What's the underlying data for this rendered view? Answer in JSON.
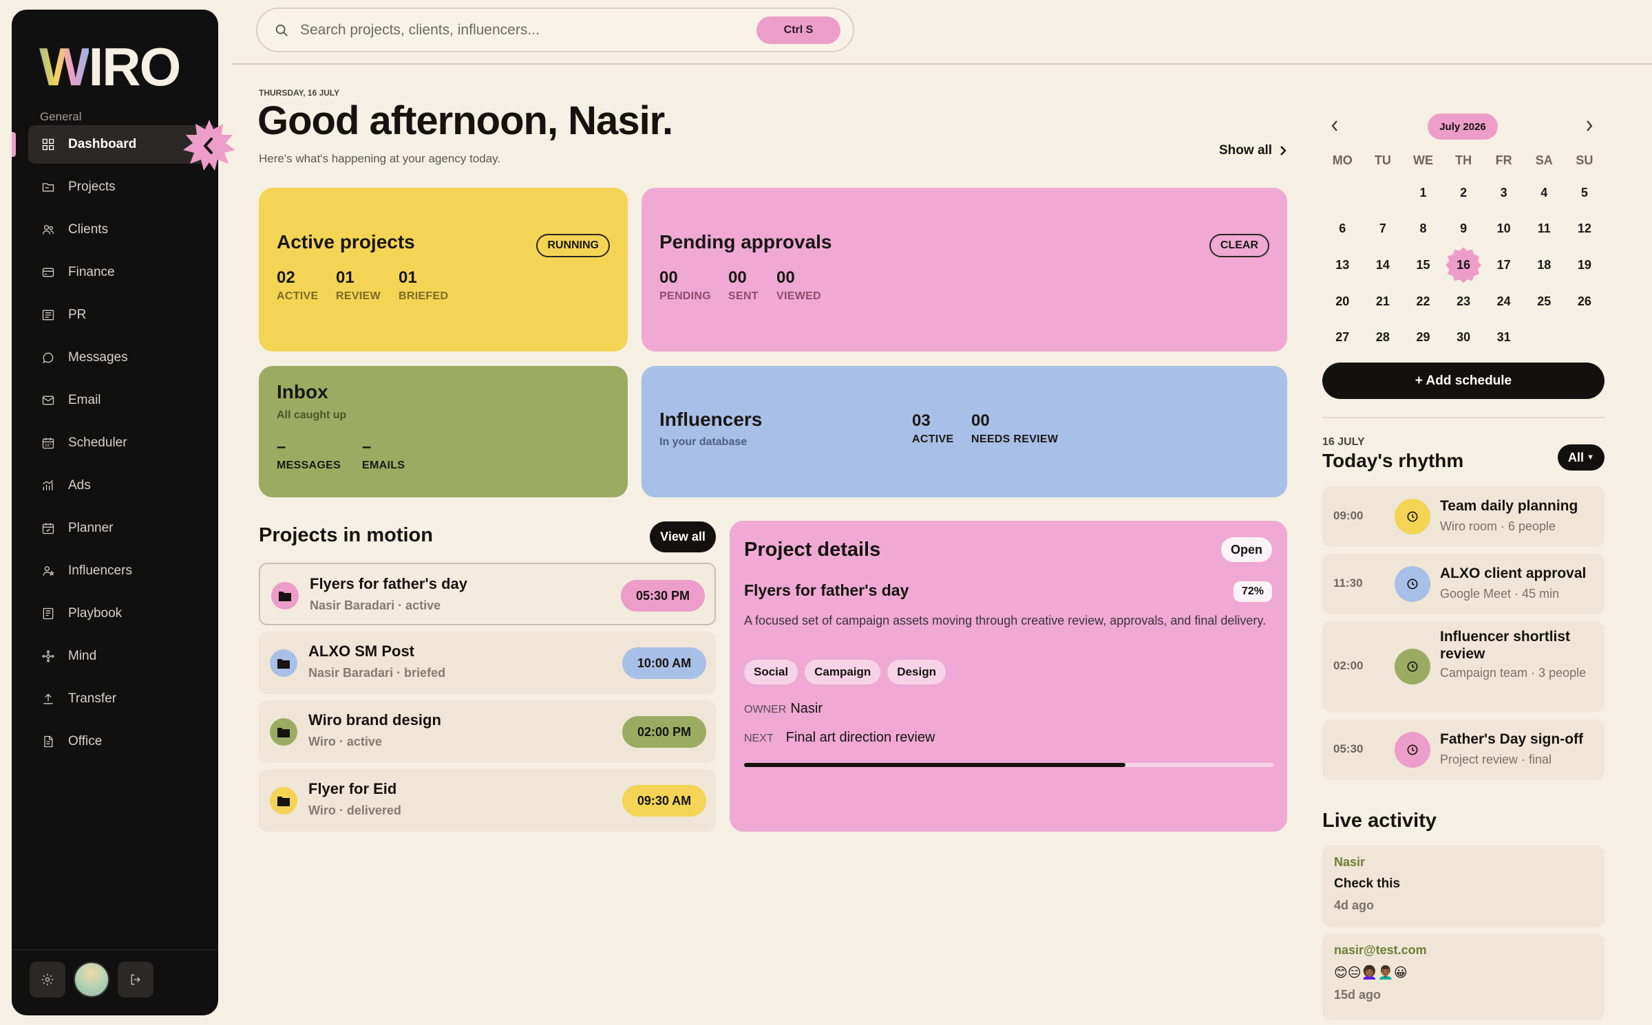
{
  "app": {
    "logo": "WIRO"
  },
  "sidebar": {
    "section": "General",
    "items": [
      {
        "label": "Dashboard",
        "icon": "grid-icon",
        "active": true
      },
      {
        "label": "Projects",
        "icon": "folder-icon"
      },
      {
        "label": "Clients",
        "icon": "users-icon"
      },
      {
        "label": "Finance",
        "icon": "card-icon"
      },
      {
        "label": "PR",
        "icon": "newspaper-icon"
      },
      {
        "label": "Messages",
        "icon": "chat-icon"
      },
      {
        "label": "Email",
        "icon": "mail-icon"
      },
      {
        "label": "Scheduler",
        "icon": "calendar-icon"
      },
      {
        "label": "Ads",
        "icon": "chart-icon"
      },
      {
        "label": "Planner",
        "icon": "planner-icon"
      },
      {
        "label": "Influencers",
        "icon": "person-star-icon"
      },
      {
        "label": "Playbook",
        "icon": "book-icon"
      },
      {
        "label": "Mind",
        "icon": "nodes-icon"
      },
      {
        "label": "Transfer",
        "icon": "upload-icon"
      },
      {
        "label": "Office",
        "icon": "document-icon"
      }
    ]
  },
  "search": {
    "placeholder": "Search projects, clients, influencers...",
    "shortcut": "Ctrl S"
  },
  "header": {
    "date": "THURSDAY, 16 JULY",
    "greeting": "Good afternoon, Nasir.",
    "subtitle": "Here's what's happening at your agency today.",
    "show_all": "Show all"
  },
  "cards": {
    "active_projects": {
      "title": "Active projects",
      "badge": "RUNNING",
      "stats": [
        {
          "value": "02",
          "label": "ACTIVE"
        },
        {
          "value": "01",
          "label": "REVIEW"
        },
        {
          "value": "01",
          "label": "BRIEFED"
        }
      ]
    },
    "pending_approvals": {
      "title": "Pending approvals",
      "badge": "CLEAR",
      "stats": [
        {
          "value": "00",
          "label": "PENDING"
        },
        {
          "value": "00",
          "label": "SENT"
        },
        {
          "value": "00",
          "label": "VIEWED"
        }
      ]
    },
    "inbox": {
      "title": "Inbox",
      "subtitle": "All caught up",
      "stats": [
        {
          "value": "–",
          "label": "MESSAGES"
        },
        {
          "value": "–",
          "label": "EMAILS"
        }
      ]
    },
    "influencers": {
      "title": "Influencers",
      "subtitle": "In your database",
      "stats": [
        {
          "value": "03",
          "label": "ACTIVE"
        },
        {
          "value": "00",
          "label": "NEEDS REVIEW"
        }
      ]
    }
  },
  "projects_in_motion": {
    "title": "Projects in motion",
    "view_all": "View all",
    "items": [
      {
        "name": "Flyers for father's day",
        "meta": "Nasir Baradari · active",
        "time": "05:30 PM",
        "color": "#ed9dc9"
      },
      {
        "name": "ALXO SM Post",
        "meta": "Nasir Baradari · briefed",
        "time": "10:00 AM",
        "color": "#a8bfe7"
      },
      {
        "name": "Wiro brand design",
        "meta": "Wiro · active",
        "time": "02:00 PM",
        "color": "#9bac62"
      },
      {
        "name": "Flyer for Eid",
        "meta": "Wiro · delivered",
        "time": "09:30 AM",
        "color": "#f4d455"
      }
    ]
  },
  "project_details": {
    "title": "Project details",
    "open": "Open",
    "name": "Flyers for father's day",
    "progress_label": "72%",
    "progress": 0.72,
    "description": "A focused set of campaign assets moving through creative review, approvals, and final delivery.",
    "tags": [
      "Social",
      "Campaign",
      "Design"
    ],
    "owner_label": "OWNER",
    "owner": "Nasir",
    "next_label": "NEXT",
    "next": "Final art direction review"
  },
  "calendar": {
    "month": "July 2026",
    "weekdays": [
      "MO",
      "TU",
      "WE",
      "TH",
      "FR",
      "SA",
      "SU"
    ],
    "leading_blanks": 2,
    "days": 31,
    "today": 16,
    "add_schedule": "+ Add schedule"
  },
  "rhythm": {
    "date": "16 JULY",
    "title": "Today's rhythm",
    "filter": "All",
    "events": [
      {
        "time": "09:00",
        "title": "Team daily planning",
        "meta": "Wiro room · 6 people",
        "color": "#f4d455"
      },
      {
        "time": "11:30",
        "title": "ALXO client approval",
        "meta": "Google Meet · 45 min",
        "color": "#a8bfe7"
      },
      {
        "time": "02:00",
        "title": "Influencer shortlist review",
        "meta": "Campaign team · 3 people",
        "color": "#9bac62"
      },
      {
        "time": "05:30",
        "title": "Father's Day sign-off",
        "meta": "Project review · final",
        "color": "#ed9dc9"
      }
    ]
  },
  "live_activity": {
    "title": "Live activity",
    "items": [
      {
        "user": "Nasir",
        "message": "Check this",
        "ago": "4d ago"
      },
      {
        "user": "nasir@test.com",
        "message": "😊😑👩🏾‍🦱👨🏾‍🦱😀",
        "ago": "15d ago"
      }
    ]
  }
}
